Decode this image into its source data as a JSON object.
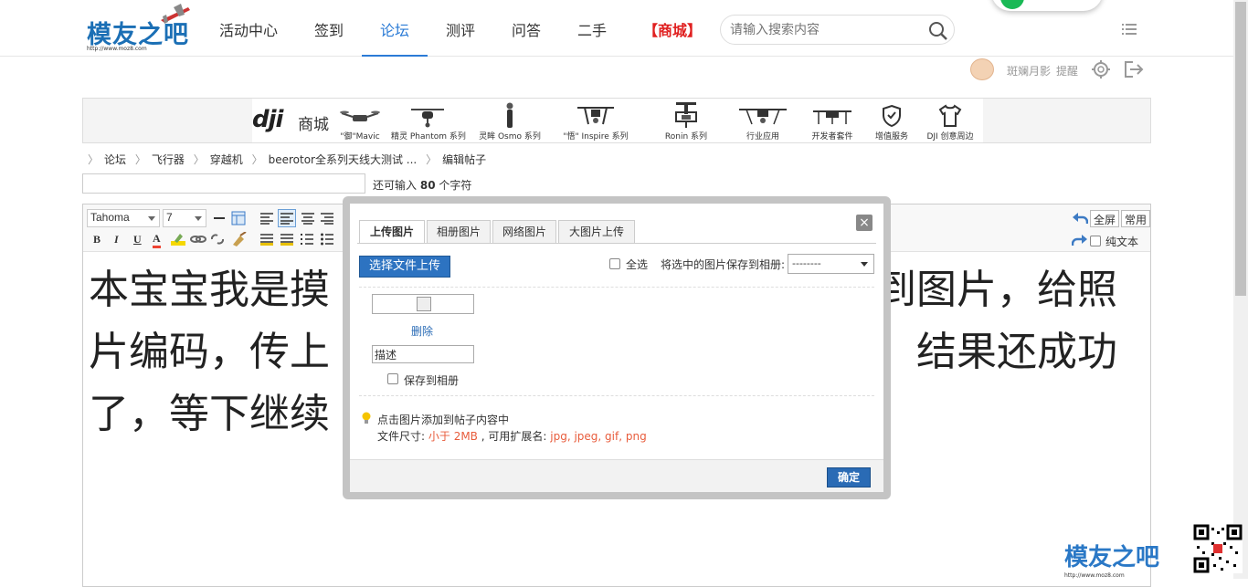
{
  "header": {
    "logo_text": "模友之吧",
    "logo_url": "http://www.moz8.com",
    "nav": [
      {
        "label": "活动中心"
      },
      {
        "label": "签到"
      },
      {
        "label": "论坛",
        "active": true
      },
      {
        "label": "测评"
      },
      {
        "label": "问答"
      },
      {
        "label": "二手"
      },
      {
        "label": "【商城】",
        "highlight": true
      }
    ],
    "search_placeholder": "请输入搜索内容",
    "active_color": "#2b7bd6",
    "mall_color": "#e02020"
  },
  "user": {
    "name": "斑斓月影",
    "remind": "提醒"
  },
  "dji_banner": {
    "brand": "dji",
    "brand_suffix": "商城",
    "items": [
      {
        "label": "\"御\"Mavic",
        "icon": "mavic-drone-icon"
      },
      {
        "label": "精灵 Phantom 系列",
        "icon": "phantom-drone-icon"
      },
      {
        "label": "灵眸 Osmo 系列",
        "icon": "osmo-gimbal-icon"
      },
      {
        "label": "\"悟\" Inspire 系列",
        "icon": "inspire-drone-icon"
      },
      {
        "label": "Ronin 系列",
        "icon": "ronin-gimbal-icon"
      },
      {
        "label": "行业应用",
        "icon": "industry-drone-icon"
      },
      {
        "label": "开发者套件",
        "icon": "developer-kit-icon"
      },
      {
        "label": "增值服务",
        "icon": "shield-icon"
      },
      {
        "label": "DJI 创意周边",
        "icon": "tshirt-icon"
      }
    ]
  },
  "breadcrumb": [
    "论坛",
    "飞行器",
    "穿越机",
    "beerotor全系列天线大测试 ...",
    "编辑帖子"
  ],
  "subject": {
    "value": "",
    "hint_prefix": "还可输入",
    "hint_count": "80",
    "hint_suffix": "个字符"
  },
  "editor": {
    "font_family": "Tahoma",
    "font_size": "7",
    "btn_fullscreen": "全屏",
    "btn_common": "常用",
    "plain_text": "纯文本",
    "content_lines": [
      "本宝宝我是摸",
      "到图片，给照",
      "片编码，传上",
      "，结果还成功",
      "了，等下继续"
    ]
  },
  "dialog": {
    "tabs": [
      "上传图片",
      "相册图片",
      "网络图片",
      "大图片上传"
    ],
    "close": "×",
    "choose_file": "选择文件上传",
    "select_all": "全选",
    "save_selected_label": "将选中的图片保存到相册:",
    "album_value": "--------",
    "delete": "删除",
    "description_value": "描述",
    "save_to_album": "保存到相册",
    "tip_line1": "点击图片添加到帖子内容中",
    "tip_size_label": "文件尺寸:",
    "tip_size_value": "小于 2MB",
    "tip_ext_label": ", 可用扩展名:",
    "tip_ext_value": "jpg, jpeg, gif, png",
    "ok": "确定"
  },
  "watermark": {
    "text": "模友之吧",
    "url": "http://www.moz8.com"
  }
}
